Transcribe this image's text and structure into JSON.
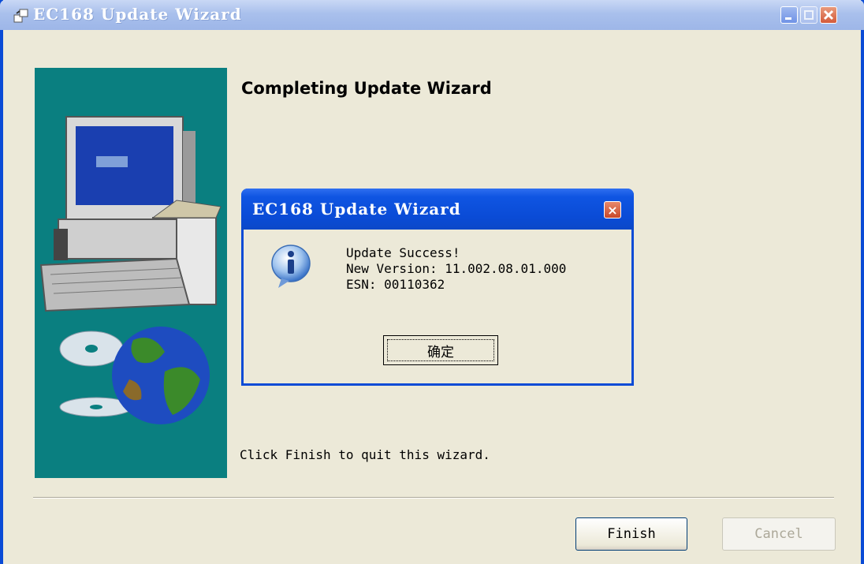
{
  "window": {
    "title": "EC168 Update Wizard",
    "heading": "Completing Update Wizard",
    "finish_hint": "Click Finish to quit this wizard.",
    "buttons": {
      "finish": "Finish",
      "cancel": "Cancel"
    }
  },
  "dialog": {
    "title": "EC168 Update Wizard",
    "close_glyph": "×",
    "icon": "info-icon",
    "lines": [
      "Update Success!",
      "New Version: 11.002.08.01.000",
      "ESN: 00110362"
    ],
    "ok_label": "确定"
  },
  "colors": {
    "titlebar_active": "#0a4bd6",
    "panel_teal": "#0a7f80",
    "window_bg": "#ece9d8"
  }
}
